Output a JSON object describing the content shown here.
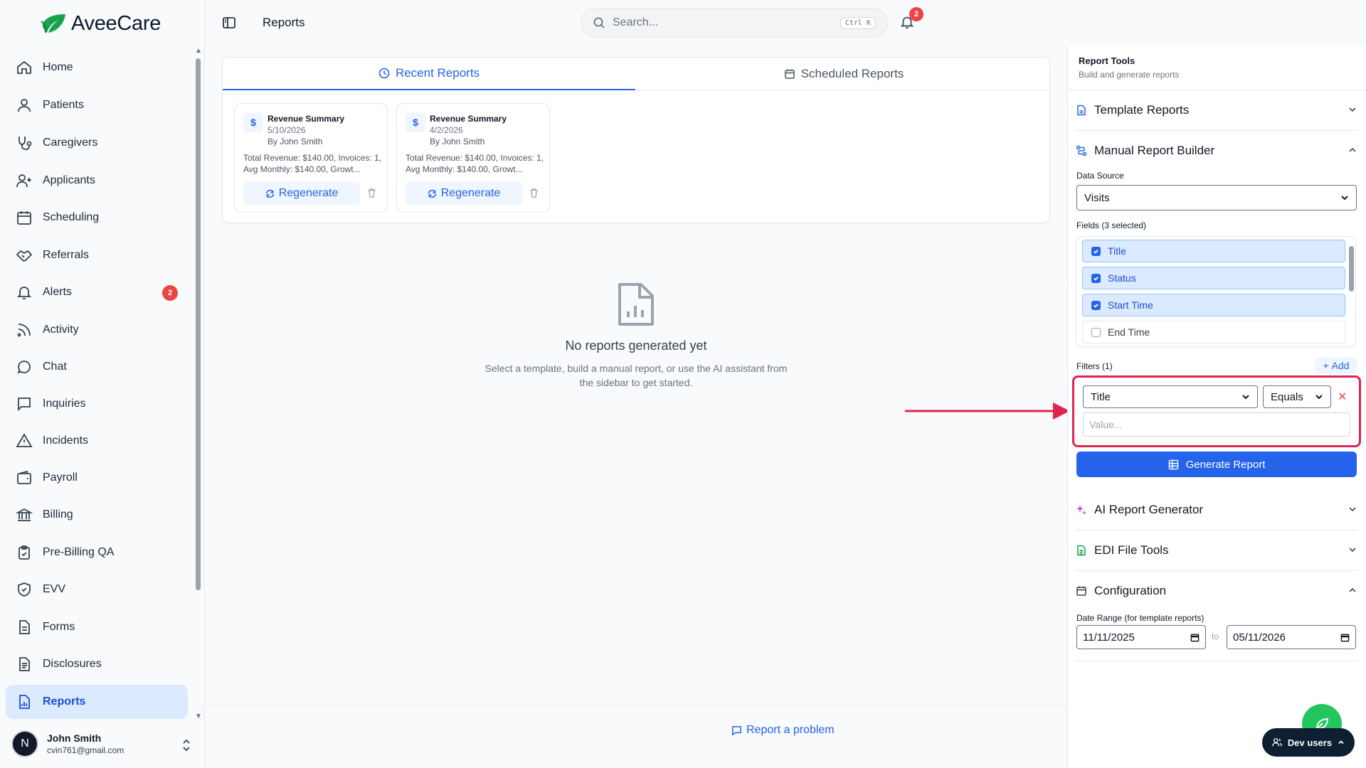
{
  "brand": {
    "name": "AveeCare",
    "color": "#22c55e"
  },
  "sidebar": {
    "items": [
      {
        "label": "Home",
        "icon": "home-icon"
      },
      {
        "label": "Patients",
        "icon": "user-icon"
      },
      {
        "label": "Caregivers",
        "icon": "stethoscope-icon"
      },
      {
        "label": "Applicants",
        "icon": "user-plus-icon"
      },
      {
        "label": "Scheduling",
        "icon": "calendar-icon"
      },
      {
        "label": "Referrals",
        "icon": "handshake-icon"
      },
      {
        "label": "Alerts",
        "icon": "bell-icon",
        "badge": "2"
      },
      {
        "label": "Activity",
        "icon": "rss-icon"
      },
      {
        "label": "Chat",
        "icon": "chat-bubble-icon"
      },
      {
        "label": "Inquiries",
        "icon": "message-square-icon"
      },
      {
        "label": "Incidents",
        "icon": "alert-triangle-icon"
      },
      {
        "label": "Payroll",
        "icon": "wallet-icon"
      },
      {
        "label": "Billing",
        "icon": "bank-icon"
      },
      {
        "label": "Pre-Billing QA",
        "icon": "clipboard-check-icon"
      },
      {
        "label": "EVV",
        "icon": "shield-check-icon"
      },
      {
        "label": "Forms",
        "icon": "file-text-icon"
      },
      {
        "label": "Disclosures",
        "icon": "file-list-icon"
      },
      {
        "label": "Reports",
        "icon": "file-chart-icon",
        "active": true
      }
    ],
    "user": {
      "initial": "N",
      "name": "John Smith",
      "email": "cvin761@gmail.com"
    }
  },
  "header": {
    "title": "Reports",
    "search_placeholder": "Search...",
    "search_shortcut": "Ctrl K",
    "notification_count": "2"
  },
  "main": {
    "tabs": [
      {
        "label": "Recent Reports",
        "active": true
      },
      {
        "label": "Scheduled Reports",
        "active": false
      }
    ],
    "reports": [
      {
        "title": "Revenue Summary",
        "date": "5/10/2026",
        "author": "By John Smith",
        "summary": "Total Revenue: $140.00, Invoices: 1, Avg Monthly: $140.00, Growt...",
        "action": "Regenerate"
      },
      {
        "title": "Revenue Summary",
        "date": "4/2/2026",
        "author": "By John Smith",
        "summary": "Total Revenue: $140.00, Invoices: 1, Avg Monthly: $140.00, Growt...",
        "action": "Regenerate"
      }
    ],
    "empty_title": "No reports generated yet",
    "empty_desc": "Select a template, build a manual report, or use the AI assistant from the sidebar to get started.",
    "report_problem": "Report a problem"
  },
  "right_panel": {
    "title": "Report Tools",
    "subtitle": "Build and generate reports",
    "sections": {
      "template": "Template Reports",
      "manual": "Manual Report Builder",
      "ai": "AI Report Generator",
      "edi": "EDI File Tools",
      "config": "Configuration"
    },
    "data_source_label": "Data Source",
    "data_source_value": "Visits",
    "fields_label": "Fields (3 selected)",
    "fields": [
      {
        "label": "Title",
        "checked": true
      },
      {
        "label": "Status",
        "checked": true
      },
      {
        "label": "Start Time",
        "checked": true
      },
      {
        "label": "End Time",
        "checked": false
      }
    ],
    "filters_label": "Filters (1)",
    "add_label": "Add",
    "filter": {
      "field": "Title",
      "operator": "Equals",
      "value_placeholder": "Value..."
    },
    "generate_label": "Generate Report",
    "date_range_label": "Date Range (for template reports)",
    "date_from": "11/11/2025",
    "date_to": "05/11/2026",
    "to_label": "to"
  },
  "dev_users": "Dev users",
  "colors": {
    "accent": "#2563eb",
    "highlight_box": "#dc2650",
    "badge": "#ef4444"
  }
}
